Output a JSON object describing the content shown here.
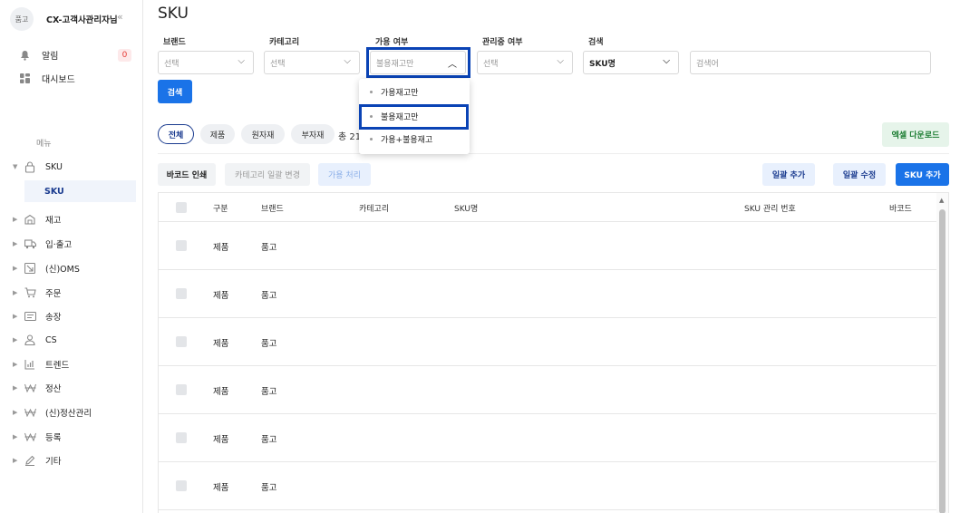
{
  "sidebar": {
    "avatar": "품고",
    "company": "CX-고객사관리자님",
    "collapse_icon": "«",
    "alerts_label": "알림",
    "alerts_count": "0",
    "dashboard_label": "대시보드",
    "menu_title": "메뉴",
    "items": [
      {
        "label": "SKU",
        "icon": "lock-icon",
        "expanded": true
      },
      {
        "label": "재고",
        "icon": "warehouse-icon"
      },
      {
        "label": "입·출고",
        "icon": "truck-icon"
      },
      {
        "label": "(신)OMS",
        "icon": "oms-icon"
      },
      {
        "label": "주문",
        "icon": "cart-icon"
      },
      {
        "label": "송장",
        "icon": "invoice-icon"
      },
      {
        "label": "CS",
        "icon": "person-icon"
      },
      {
        "label": "트렌드",
        "icon": "chart-icon"
      },
      {
        "label": "정산",
        "icon": "won-icon"
      },
      {
        "label": "(신)정산관리",
        "icon": "won-icon"
      },
      {
        "label": "등록",
        "icon": "won-icon"
      },
      {
        "label": "기타",
        "icon": "pencil-icon"
      }
    ],
    "sub_item": "SKU"
  },
  "page": {
    "title": "SKU"
  },
  "filters": {
    "brand": {
      "label": "브랜드",
      "value": "선택"
    },
    "category": {
      "label": "카테고리",
      "value": "선택"
    },
    "availability": {
      "label": "가용 여부",
      "value": "불용재고만"
    },
    "managed": {
      "label": "관리중 여부",
      "value": "선택"
    },
    "search_type": {
      "label": "검색",
      "value": "SKU명"
    },
    "search_input": {
      "placeholder": "검색어"
    },
    "search_button": "검색"
  },
  "dropdown": {
    "options": [
      "가용재고만",
      "불용재고만",
      "가용+불용재고"
    ],
    "selected": "불용재고만"
  },
  "tabs": [
    "전체",
    "제품",
    "원자재",
    "부자재"
  ],
  "total": "총 21",
  "excel_button": "엑셀 다운로드",
  "toolbar": {
    "barcode_print": "바코드 인쇄",
    "category_bulk": "카테고리 일괄 변경",
    "avail_process": "가용 처리",
    "bulk_add": "일괄 추가",
    "bulk_edit": "일괄 수정",
    "add_sku": "SKU 추가"
  },
  "table": {
    "columns": [
      "구분",
      "브랜드",
      "카테고리",
      "SKU명",
      "SKU 관리 번호",
      "바코드"
    ],
    "rows": [
      {
        "type": "제품",
        "brand": "품고"
      },
      {
        "type": "제품",
        "brand": "품고"
      },
      {
        "type": "제품",
        "brand": "품고"
      },
      {
        "type": "제품",
        "brand": "품고"
      },
      {
        "type": "제품",
        "brand": "품고"
      },
      {
        "type": "제품",
        "brand": "품고"
      }
    ]
  },
  "colors": {
    "primary": "#1a73e8",
    "highlight": "#0a43b5",
    "navy": "#1a3b8f",
    "excel_bg": "#e6f4ea",
    "excel_text": "#1e7e34"
  }
}
